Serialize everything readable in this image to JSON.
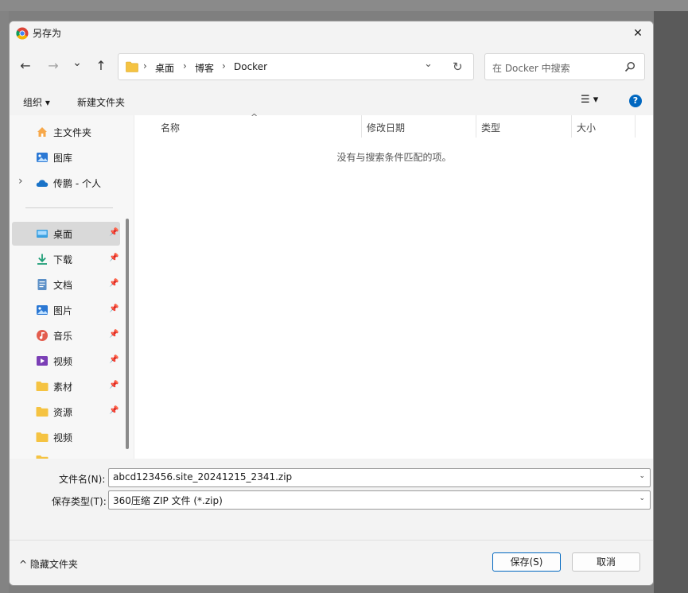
{
  "window": {
    "title": "另存为",
    "close_glyph": "✕"
  },
  "nav": {
    "back_glyph": "←",
    "forward_glyph": "→",
    "recent_glyph": "⌄",
    "up_glyph": "↑",
    "breadcrumb": [
      "桌面",
      "博客",
      "Docker"
    ],
    "separator": "›",
    "refresh_glyph": "↻",
    "search_placeholder": "在 Docker 中搜索"
  },
  "toolbar": {
    "organize_label": "组织 ▾",
    "new_folder_label": "新建文件夹",
    "view_glyph": "☰ ▾",
    "help_glyph": "?"
  },
  "sidebar": {
    "top_items": [
      {
        "label": "主文件夹",
        "icon": "home-icon"
      },
      {
        "label": "图库",
        "icon": "gallery-icon"
      },
      {
        "label": "传鹏 - 个人",
        "icon": "onedrive-cloud-icon"
      }
    ],
    "pinned_items": [
      {
        "label": "桌面",
        "icon": "desktop-icon"
      },
      {
        "label": "下载",
        "icon": "download-icon"
      },
      {
        "label": "文档",
        "icon": "document-icon"
      },
      {
        "label": "图片",
        "icon": "pictures-icon"
      },
      {
        "label": "音乐",
        "icon": "music-icon"
      },
      {
        "label": "视频",
        "icon": "video-icon"
      },
      {
        "label": "素材",
        "icon": "folder-icon"
      },
      {
        "label": "资源",
        "icon": "folder-icon"
      }
    ],
    "other_items": [
      {
        "label": "视频",
        "icon": "folder-icon"
      }
    ],
    "pin_glyph": "📌",
    "expand_glyph": "›"
  },
  "file_list": {
    "columns": [
      "名称",
      "修改日期",
      "类型",
      "大小"
    ],
    "sort_glyph": "^",
    "empty_message": "没有与搜索条件匹配的项。"
  },
  "form": {
    "filename_label": "文件名(N):",
    "filename_value": "abcd123456.site_20241215_2341.zip",
    "filetype_label": "保存类型(T):",
    "filetype_value": "360压缩 ZIP 文件 (*.zip)",
    "dropdown_glyph": "⌄"
  },
  "footer": {
    "hide_folders_label": "^ 隐藏文件夹",
    "save_label": "保存(S)",
    "cancel_label": "取消"
  },
  "colors": {
    "accent": "#0067c0",
    "folder": "#f5c342",
    "selected_bg": "#d9d9d9"
  }
}
